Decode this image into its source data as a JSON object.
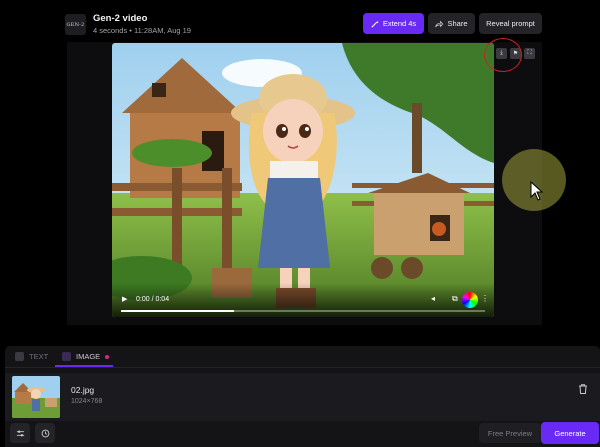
{
  "header": {
    "logo_text": "GEN-2",
    "title": "Gen-2 video",
    "meta": "4 seconds • 11:28AM, Aug 19",
    "extend_label": "Extend 4s",
    "share_label": "Share",
    "reveal_label": "Reveal prompt"
  },
  "video": {
    "time": "0:00 / 0:04",
    "progress_fraction": 0.31,
    "tools": [
      "download-icon",
      "flag-icon",
      "fullscreen-icon"
    ]
  },
  "panel": {
    "tabs": [
      {
        "label": "TEXT",
        "active": false
      },
      {
        "label": "IMAGE",
        "active": true
      }
    ],
    "file": {
      "name": "02.jpg",
      "dims": "1024×768"
    },
    "free_preview_label": "Free Preview",
    "generate_label": "Generate"
  },
  "colors": {
    "accent": "#6a2af5",
    "tab_dot": "#d0288a",
    "background": "#000000",
    "panel": "#141417"
  }
}
